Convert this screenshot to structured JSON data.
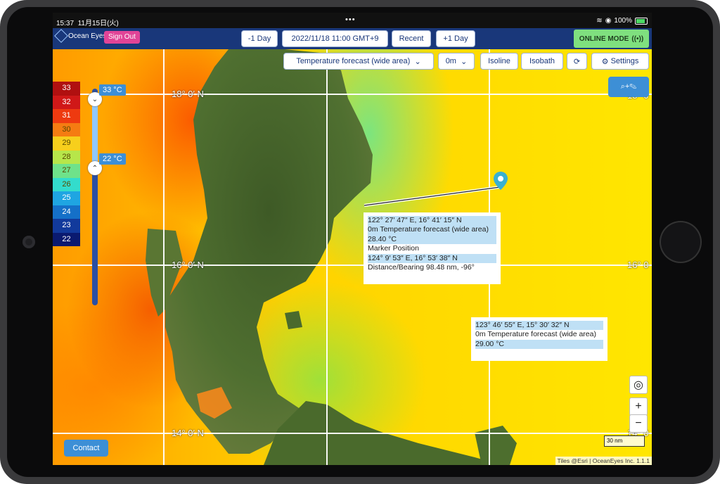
{
  "status": {
    "time": "15:37",
    "date": "11月15日(火)",
    "battery": "100%"
  },
  "header": {
    "logo": "Ocean Eyes",
    "sign_out": "Sign Out",
    "prev_day": "-1 Day",
    "datetime": "2022/11/18 11:00 GMT+9",
    "recent": "Recent",
    "next_day": "+1 Day",
    "online_mode": "ONLINE MODE"
  },
  "toolbar": {
    "layer": "Temperature forecast (wide area)",
    "depth": "0m",
    "isoline": "Isoline",
    "isobath": "Isobath",
    "settings": "Settings"
  },
  "legend": {
    "labels": [
      "33",
      "32",
      "31",
      "30",
      "29",
      "28",
      "27",
      "26",
      "25",
      "24",
      "23",
      "22"
    ],
    "colors": [
      "#b01010",
      "#d01818",
      "#ee3a10",
      "#f57c12",
      "#f7cf1c",
      "#b7e64a",
      "#6fe28a",
      "#33dccc",
      "#1fa5e2",
      "#1570c8",
      "#123a9c",
      "#0a1a70"
    ],
    "max_tag": "33 °C",
    "min_tag": "22 °C"
  },
  "grid": {
    "lat_18": "18° 0′ N",
    "lat_16": "16° 0′ N",
    "lat_16_right": "16° 0",
    "lat_14": "14° 0′ N",
    "lat_14_right": "14° 0",
    "lat_18_right": "18° 0"
  },
  "popup1": {
    "line1": "122° 27′ 47″ E, 16° 41′ 15″ N",
    "line2": "0m Temperature forecast (wide area)",
    "line3": "28.40 °C",
    "line4": "Marker Position",
    "line5": "124° 9′ 53″ E, 16° 53′ 38″ N",
    "line6": "Distance/Bearing 98.48 nm, -96°"
  },
  "popup2": {
    "line1": "123° 46′ 55″ E, 15° 30′ 32″ N",
    "line2": "0m Temperature forecast (wide area)",
    "line3": "29.00 °C"
  },
  "map_controls": {
    "zoom_in": "+",
    "zoom_out": "−"
  },
  "contact": "Contact",
  "scale": "30 nm",
  "attribution": "Tiles @Esri | OceanEyes Inc. 1.1.1"
}
